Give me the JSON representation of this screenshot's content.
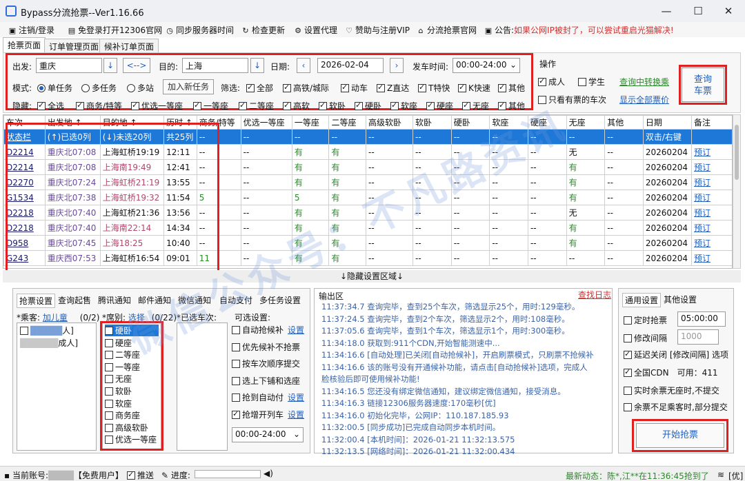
{
  "window": {
    "title": "Bypass分流抢票--Ver1.16.66",
    "min": "—",
    "max": "☐",
    "close": "✕"
  },
  "menu": [
    {
      "icon": "▣",
      "label": "注销/登录"
    },
    {
      "icon": "▤",
      "label": "免登录打开12306官网"
    },
    {
      "icon": "◷",
      "label": "同步服务器时间"
    },
    {
      "icon": "↻",
      "label": "检查更新"
    },
    {
      "icon": "⚙",
      "label": "设置代理"
    },
    {
      "icon": "♡",
      "label": "赞助与注册VIP"
    },
    {
      "icon": "⌂",
      "label": "分流抢票官网"
    }
  ],
  "notice": {
    "label": "公告:",
    "text": "如果公网IP被封了，可以尝试重启光猫解决!"
  },
  "main_tabs": [
    "抢票页面",
    "订单管理页面",
    "候补订单页面"
  ],
  "query": {
    "from_label": "出发:",
    "from": "重庆",
    "swap": "<-->",
    "to_label": "目的:",
    "to": "上海",
    "date_label": "日期:",
    "date": "2026-02-04",
    "time_label": "发车时间:",
    "time": "00:00-24:00",
    "mode_label": "模式:",
    "modes": [
      "单任务",
      "多任务",
      "多站"
    ],
    "add_task": "加入新任务",
    "filter_label": "筛选:",
    "filters": [
      "全部",
      "高铁/城际",
      "动车",
      "Z直达",
      "T特快",
      "K快速",
      "其他"
    ],
    "hide_label": "隐藏:",
    "hides": [
      "全选",
      "商务/特等",
      "优选一等座",
      "一等座",
      "二等座",
      "高软",
      "软卧",
      "硬卧",
      "软座",
      "硬座",
      "无座",
      "其他"
    ]
  },
  "ops": {
    "title": "操作",
    "adult": "成人",
    "student": "学生",
    "transfer": "查询中转换乘",
    "only_ticket": "只看有票的车次",
    "show_all_price": "显示全部票价",
    "query_btn_line1": "查询",
    "query_btn_line2": "车票"
  },
  "table": {
    "headers": [
      "车次",
      "出发地 ↕",
      "目的地 ↕",
      "历时 ↕",
      "商务/特等",
      "优选一等座",
      "一等座",
      "二等座",
      "高级软卧",
      "软卧",
      "硬卧",
      "软座",
      "硬座",
      "无座",
      "其他",
      "日期",
      "备注"
    ],
    "status_row": [
      "状态栏",
      "(↑)已选0列",
      "(↓)未选20列",
      "共25列",
      "--",
      "--",
      "--",
      "--",
      "--",
      "--",
      "--",
      "--",
      "--",
      "--",
      "--",
      "双击/右键",
      ""
    ],
    "rows": [
      [
        "D2214",
        "重庆北07:08",
        "上海虹桥19:19",
        "12:11",
        "--",
        "--",
        "有",
        "有",
        "--",
        "--",
        "--",
        "--",
        "--",
        "无",
        "--",
        "20260204",
        "预订"
      ],
      [
        "D2214",
        "重庆北07:08",
        "上海南19:49",
        "12:41",
        "--",
        "--",
        "有",
        "有",
        "--",
        "--",
        "--",
        "--",
        "--",
        "有",
        "--",
        "20260204",
        "预订"
      ],
      [
        "D2270",
        "重庆北07:24",
        "上海虹桥21:19",
        "13:55",
        "--",
        "--",
        "有",
        "有",
        "--",
        "--",
        "--",
        "--",
        "--",
        "有",
        "--",
        "20260204",
        "预订"
      ],
      [
        "G1534",
        "重庆北07:38",
        "上海虹桥19:32",
        "11:54",
        "5",
        "--",
        "5",
        "有",
        "--",
        "--",
        "--",
        "--",
        "--",
        "有",
        "--",
        "20260204",
        "预订"
      ],
      [
        "D2218",
        "重庆北07:40",
        "上海虹桥21:36",
        "13:56",
        "--",
        "--",
        "有",
        "有",
        "--",
        "--",
        "--",
        "--",
        "--",
        "无",
        "--",
        "20260204",
        "预订"
      ],
      [
        "D2218",
        "重庆北07:40",
        "上海南22:14",
        "14:34",
        "--",
        "--",
        "有",
        "有",
        "--",
        "--",
        "--",
        "--",
        "--",
        "有",
        "--",
        "20260204",
        "预订"
      ],
      [
        "D958",
        "重庆北07:45",
        "上海18:25",
        "10:40",
        "--",
        "--",
        "有",
        "有",
        "--",
        "--",
        "--",
        "--",
        "--",
        "有",
        "--",
        "20260204",
        "预订"
      ],
      [
        "G243",
        "重庆西07:53",
        "上海虹桥16:54",
        "09:01",
        "11",
        "--",
        "有",
        "有",
        "--",
        "--",
        "--",
        "--",
        "--",
        "--",
        "--",
        "20260204",
        "预订"
      ]
    ]
  },
  "hidden_area": "↓隐藏设置区域↓",
  "left_tabs": [
    "抢票设置",
    "查询起售",
    "腾讯通知",
    "邮件通知",
    "微信通知",
    "自动支付",
    "多任务设置"
  ],
  "passenger": {
    "label": "*乘客:",
    "add_child": "加儿童",
    "count": "(0/2)",
    "items": [
      "人]",
      "成人]"
    ]
  },
  "seat": {
    "label": "*席别:",
    "select": "选择",
    "count": "(0/22)",
    "items": [
      "硬卧",
      "硬座",
      "二等座",
      "一等座",
      "无座",
      "软卧",
      "软座",
      "商务座",
      "高级软卧",
      "优选一等座"
    ]
  },
  "selected_trains_label": "*已选车次:",
  "optional": {
    "label": "可选设置:",
    "items": [
      "自动抢候补",
      "优先候补不抢票",
      "按车次顺序提交",
      "选上下铺和选座",
      "抢到自动付",
      "抢增开列车"
    ],
    "set": "设置",
    "time": "00:00-24:00"
  },
  "output": {
    "label": "输出区",
    "log_link": "查找日志",
    "lines": [
      "11:37:34.7  查询完毕，查到25个车次，筛选显示25个，用时:129毫秒。",
      "11:37:24.5  查询完毕，查到2个车次，筛选显示2个，用时:108毫秒。",
      "11:37:05.6  查询完毕，查到1个车次，筛选显示1个，用时:300毫秒。",
      "11:34:18.0  获取到:911个CDN,开始智能测速中...",
      "11:34:16.6  [自动处理]已关闭[自动抢候补]，开启刷票模式，只刷票不抢候补",
      "11:34:16.6  该的账号没有开通候补功能，请点击[自动抢候补]选项，完成人",
      "脸核验后即可使用候补功能!",
      "11:34:16.5  您还没有绑定微信通知，建议绑定微信通知，接受消息。",
      "11:34:16.3  链接12306服务器速度:170毫秒[优]",
      "11:34:16.0  初始化完毕，公网IP：110.187.185.93",
      "11:32:00.5  [同步成功]已完成自动同步本机时间。",
      "11:32:00.4  [本机时间]：2026-01-21 11:32:13.575",
      "11:32:13.5  [网络时间]：2026-01-21 11:32:00.434"
    ]
  },
  "right_tabs": [
    "通用设置",
    "其他设置"
  ],
  "general": {
    "timer_label": "定时抢票",
    "timer": "05:00:00",
    "interval_label": "修改间隔",
    "interval": "1000",
    "delay": "延迟关闭 [修改间隔] 选项",
    "cdn": "全国CDN",
    "cdn_avail": "可用：411",
    "realtime": "实时余票无座时,不提交",
    "partial": "余票不足乘客时,部分提交",
    "start": "开始抢票"
  },
  "statusbar": {
    "account": "当前账号:",
    "user_type": "【免费用户】",
    "push": "推送",
    "progress": "进度:",
    "news": "最新动态：陈*,江**在11:36:45抢到了",
    "suffix": "[优]"
  }
}
